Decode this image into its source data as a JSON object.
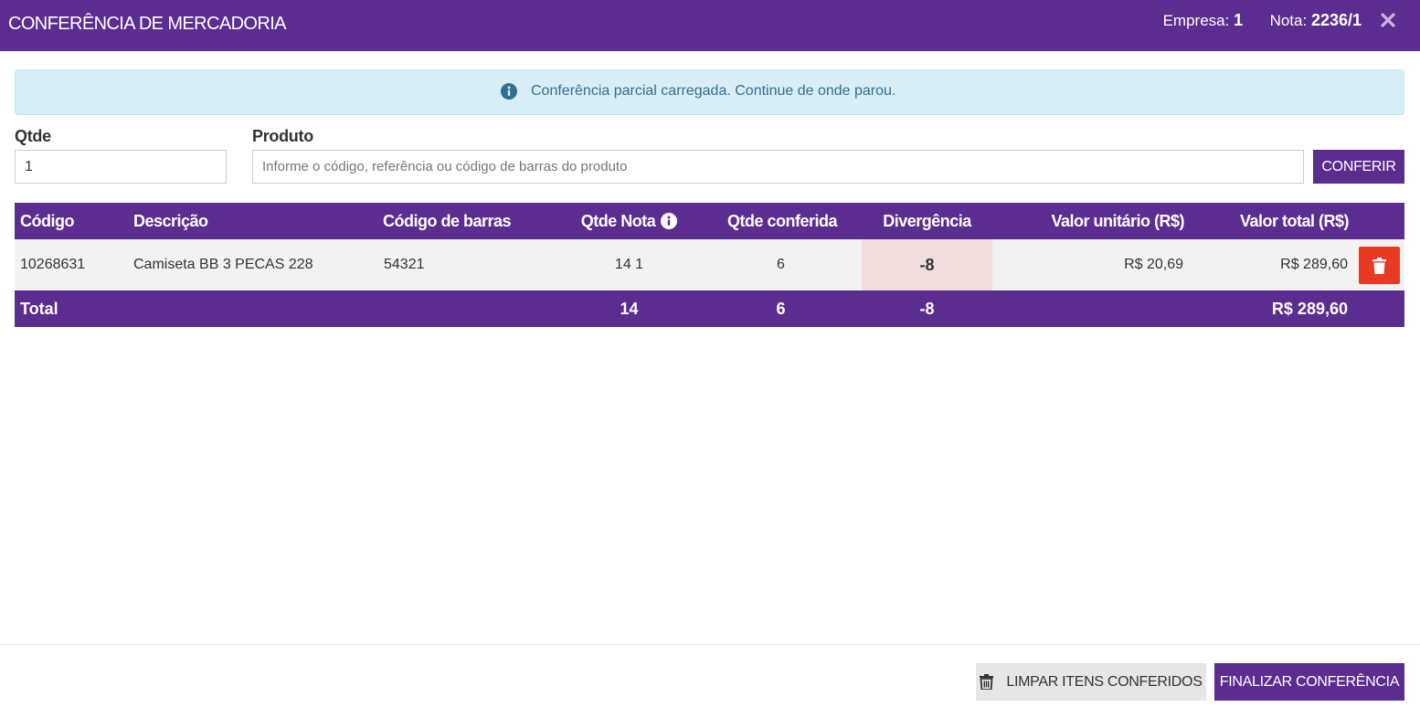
{
  "header": {
    "title": "CONFERÊNCIA DE MERCADORIA",
    "empresa_label": "Empresa:",
    "empresa_value": "1",
    "nota_label": "Nota:",
    "nota_value": "2236/1",
    "close_icon": "close-icon"
  },
  "alert": {
    "icon": "info-circle-icon",
    "message": "Conferência parcial carregada. Continue de onde parou."
  },
  "form": {
    "qtde_label": "Qtde",
    "qtde_value": "1",
    "produto_label": "Produto",
    "produto_placeholder": "Informe o código, referência ou código de barras do produto",
    "conferir_label": "CONFERIR"
  },
  "table": {
    "headers": {
      "codigo": "Código",
      "descricao": "Descrição",
      "codigo_barras": "Código de barras",
      "qtde_nota": "Qtde Nota",
      "qtde_conferida": "Qtde conferida",
      "divergencia": "Divergência",
      "valor_unitario": "Valor unitário (R$)",
      "valor_total": "Valor total (R$)"
    },
    "rows": [
      {
        "codigo": "10268631",
        "descricao": "Camiseta BB 3 PECAS 228",
        "codigo_barras": "54321",
        "qtde_nota": "14 1",
        "qtde_conferida": "6",
        "divergencia": "-8",
        "valor_unitario": "R$ 20,69",
        "valor_total": "R$ 289,60"
      }
    ],
    "total": {
      "label": "Total",
      "qtde_nota": "14",
      "qtde_conferida": "6",
      "divergencia": "-8",
      "valor_total": "R$ 289,60"
    }
  },
  "footer": {
    "limpar_label": "LIMPAR ITENS CONFERIDOS",
    "finalizar_label": "FINALIZAR CONFERÊNCIA"
  },
  "colors": {
    "brand": "#5c2d91",
    "alert_bg": "#d9edf7",
    "alert_text": "#31708f",
    "danger": "#e83a22",
    "divergence_bg": "#f2dede"
  }
}
